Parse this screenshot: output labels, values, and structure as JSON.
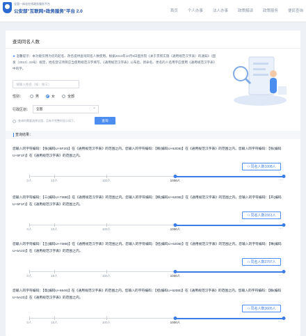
{
  "header": {
    "brand_sub": "全国一体化在线政务服务平台",
    "brand_title": "公安部\"互联网+政务服务\"平台 2.0",
    "nav": [
      "首页",
      "个人办事",
      "法人办事",
      "政策解读",
      "政策服务",
      "便民查询"
    ]
  },
  "page": {
    "title": "查询同名人数",
    "notice_star": "★",
    "notice": "温馨提示：本功能仅用为您的起名、改名提供查询同名人数使用。根据2013年10月9日国务院《关于贯彻实施〈通用规范汉字表〉的通知》（国发〔2013〕23号）规定，姓名登记项目应当使用规范汉字填写。《通用规范汉字表》公布后，新命名、更名的人名用字应使用《通用规范汉字表》中的字。",
    "search_placeholder": "请输入姓名（如：张三）",
    "gender": {
      "label": "性别：",
      "options": [
        "男",
        "女",
        "全部"
      ],
      "selected": "女"
    },
    "region": {
      "label": "行政区划：",
      "value": "全国"
    },
    "hint": "查询时需要选择全国，且有不完整时显示如下。",
    "query_button": "查询",
    "results_label": "查询结果："
  },
  "results": [
    {
      "text": "您输入的字符编码：【张(编码U+5F20)】在《通用规范汉字表》的范围之内。您输入的字符编码：【枫(编码U+62DB)】在《通用规范汉字表》的范围之内。您输入的字符编码：【张(编码U+5F1F)】在《通用规范汉字表》的范围之内。",
      "count_label": "同名人数1008人",
      "count": 1008,
      "scale_labels": [
        "0人",
        "10人",
        "100人",
        "1000人"
      ],
      "current_index": 3
    },
    {
      "text": "您输入的字符编码：【三(编码U+738B)】在《通用规范汉字表》的范围之内。您输入的字符编码：【枫(编码U+62DB)】在《通用规范汉字表》的范围之内。您输入的字符编码：【开(编码U+5F1F)】在《通用规范汉字表》的范围之内。",
      "count_label": "同名人数1561人",
      "count": 1561,
      "scale_labels": [
        "0人",
        "10人",
        "100人",
        "1000人"
      ],
      "current_index": 3
    },
    {
      "text": "您输入的字符编码：【王(编码U+738B)】在《通用规范汉字表》的范围之内。您输入的字符编码：【招(编码U+62DB)】在《通用规范汉字表》的范围之内。您输入的字符编码：【琳(编码U+5A23)】在《通用规范汉字表》的范围之内。",
      "count_label": "同名人数2797人",
      "count": 2797,
      "scale_labels": [
        "0人",
        "10人",
        "100人",
        "1000人"
      ],
      "current_index": 3
    },
    {
      "text": "您输入的字符编码：【高(编码U+6648)】在《通用规范汉字表》的范围之内。您输入的字符编码：【招(编码U+62DB)】在《通用规范汉字表》的范围之内。您输入的字符编码：【静(编码U+5A23)】在《通用规范汉字表》的范围之内。",
      "count_label": "同名人数3605人",
      "count": 3605,
      "scale_labels": [
        "0人",
        "10人",
        "100人",
        "1000人"
      ],
      "current_index": 3
    }
  ],
  "colors": {
    "accent": "#3b7ce6",
    "brand": "#1d4fa8",
    "panel": "#ffffff",
    "background": "#eef1f5"
  }
}
